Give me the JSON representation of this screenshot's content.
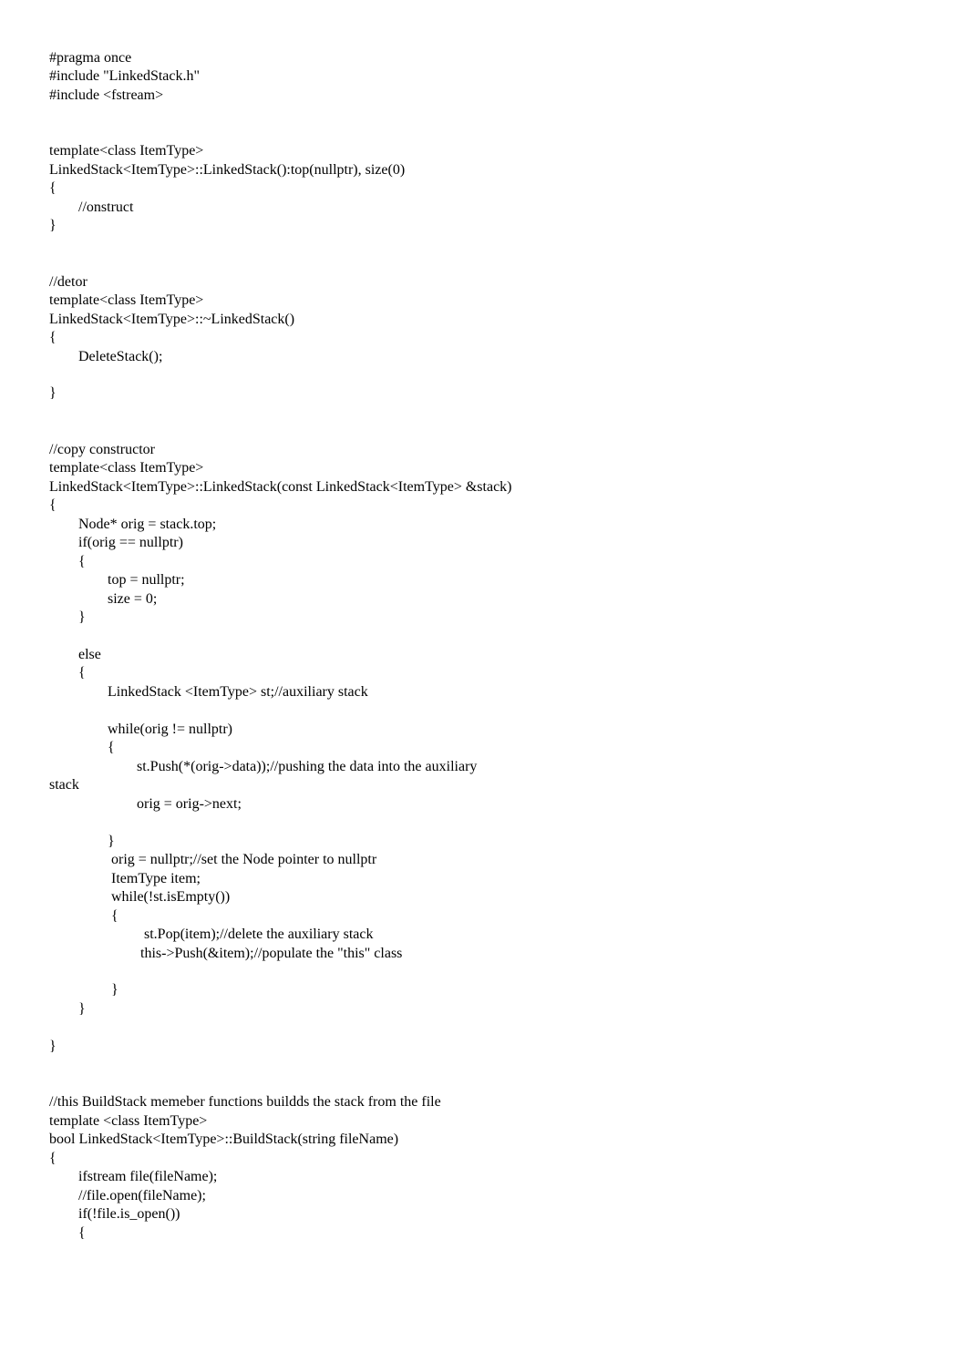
{
  "code": "#pragma once\n#include \"LinkedStack.h\"\n#include <fstream>\n\n\ntemplate<class ItemType>\nLinkedStack<ItemType>::LinkedStack():top(nullptr), size(0)\n{\n\t//onstruct\n}\n\n\n//detor\ntemplate<class ItemType>\nLinkedStack<ItemType>::~LinkedStack()\n{\n\tDeleteStack();\n\n}\n\n\n//copy constructor\ntemplate<class ItemType>\nLinkedStack<ItemType>::LinkedStack(const LinkedStack<ItemType> &stack)\n{\n\tNode* orig = stack.top;\n\tif(orig == nullptr)\n\t{\n\t\ttop = nullptr;\n\t\tsize = 0;\n\t}\n\n\telse\n\t{\n\t\tLinkedStack <ItemType> st;//auxiliary stack\n\n\t\twhile(orig != nullptr)\n\t\t{\n\t\t\tst.Push(*(orig->data));//pushing the data into the auxiliary\nstack\n\t\t\torig = orig->next;\n\n\t\t}\n\t\t orig = nullptr;//set the Node pointer to nullptr\n\t\t ItemType item;\n\t\t while(!st.isEmpty())\n\t\t {\n\t\t\t  st.Pop(item);//delete the auxiliary stack\n\t\t\t this->Push(&item);//populate the \"this\" class\n\n\t\t }\n\t}\n\n}\n\n\n//this BuildStack memeber functions buildds the stack from the file\ntemplate <class ItemType>\nbool LinkedStack<ItemType>::BuildStack(string fileName)\n{\n\tifstream file(fileName);\n\t//file.open(fileName);\n\tif(!file.is_open())\n\t{"
}
